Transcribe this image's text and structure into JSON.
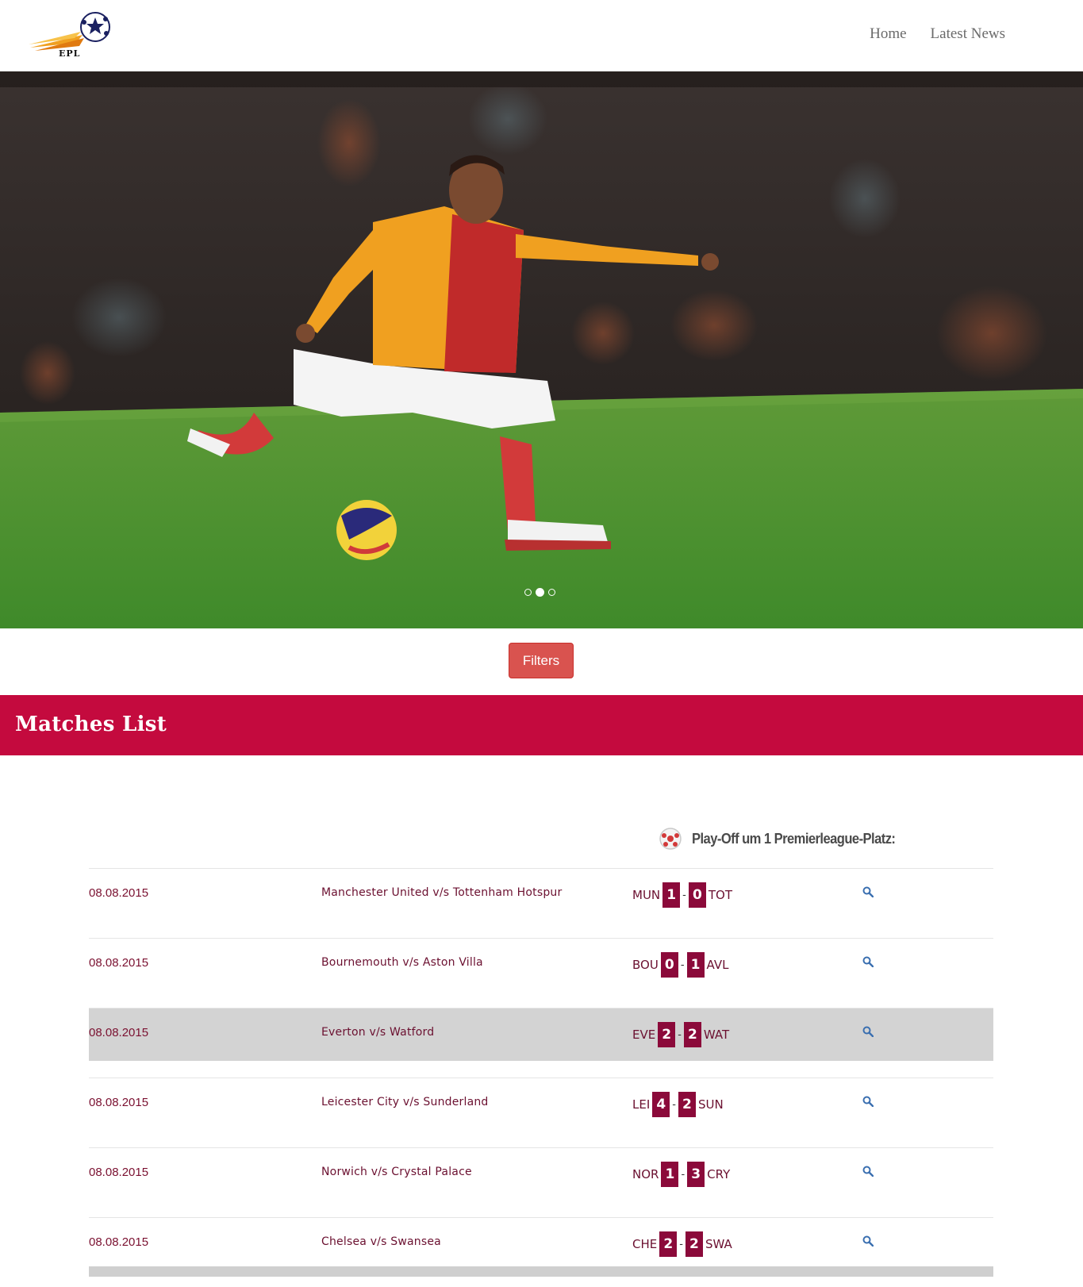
{
  "header": {
    "logo_text": "EPL",
    "nav": [
      "Home",
      "Latest News"
    ]
  },
  "hero": {
    "slides_count": 3,
    "active_slide": 2
  },
  "filters_button": "Filters",
  "banner_title": "Matches List",
  "league_title": "Play-Off um 1 Premierleague-Platz:",
  "matches": [
    {
      "date": "08.08.2015",
      "teams": "Manchester United v/s Tottenham Hotspur",
      "home": "MUN",
      "home_score": "1",
      "away_score": "0",
      "away": "TOT",
      "highlight": false
    },
    {
      "date": "08.08.2015",
      "teams": "Bournemouth v/s Aston Villa",
      "home": "BOU",
      "home_score": "0",
      "away_score": "1",
      "away": "AVL",
      "highlight": false
    },
    {
      "date": "08.08.2015",
      "teams": "Everton v/s Watford",
      "home": "EVE",
      "home_score": "2",
      "away_score": "2",
      "away": "WAT",
      "highlight": true
    },
    {
      "date": "08.08.2015",
      "teams": "Leicester City v/s Sunderland",
      "home": "LEI",
      "home_score": "4",
      "away_score": "2",
      "away": "SUN",
      "highlight": false
    },
    {
      "date": "08.08.2015",
      "teams": "Norwich v/s Crystal Palace",
      "home": "NOR",
      "home_score": "1",
      "away_score": "3",
      "away": "CRY",
      "highlight": false
    },
    {
      "date": "08.08.2015",
      "teams": "Chelsea v/s Swansea",
      "home": "CHE",
      "home_score": "2",
      "away_score": "2",
      "away": "SWA",
      "highlight": false
    }
  ],
  "colors": {
    "banner": "#c40a3e",
    "score_box": "#8b0a3a",
    "filters_button": "#d9534f",
    "row_highlight": "#d3d3d3",
    "search_icon": "#3a6fb0"
  }
}
